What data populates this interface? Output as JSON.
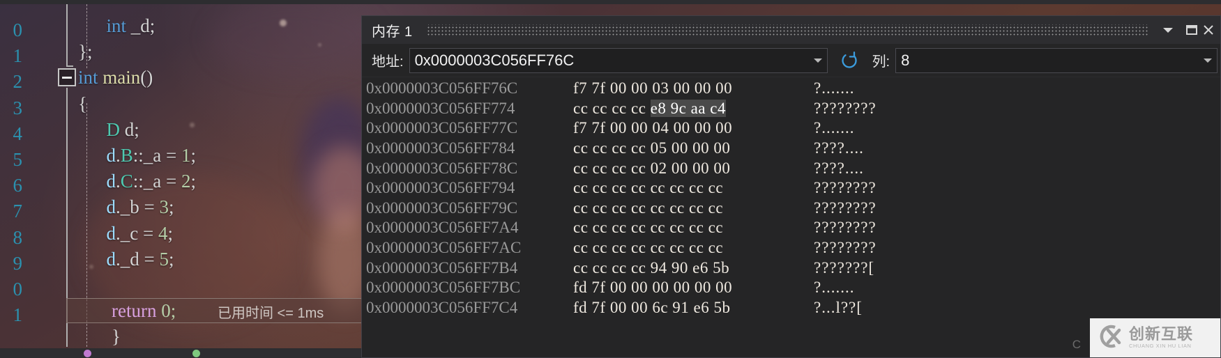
{
  "editor": {
    "line_numbers": [
      "0",
      "1",
      "2",
      "3",
      "4",
      "5",
      "6",
      "7",
      "8",
      "9",
      "0",
      "1"
    ],
    "code_lines": [
      {
        "indent": 3,
        "tokens": [
          {
            "t": "int",
            "c": "kw"
          },
          {
            "t": " _d;",
            "c": "pun"
          }
        ]
      },
      {
        "indent": 0,
        "tokens": [
          {
            "t": "};",
            "c": "pun"
          }
        ]
      },
      {
        "indent": 0,
        "tokens": [
          {
            "t": "int",
            "c": "kw"
          },
          {
            "t": " ",
            "c": "pun"
          },
          {
            "t": "main",
            "c": "fn"
          },
          {
            "t": "()",
            "c": "pun"
          }
        ]
      },
      {
        "indent": 0,
        "tokens": [
          {
            "t": "{",
            "c": "pun"
          }
        ]
      },
      {
        "indent": 3,
        "tokens": [
          {
            "t": "D",
            "c": "typ"
          },
          {
            "t": " d;",
            "c": "pun"
          }
        ]
      },
      {
        "indent": 3,
        "tokens": [
          {
            "t": "d",
            "c": "var"
          },
          {
            "t": ".",
            "c": "pun"
          },
          {
            "t": "B",
            "c": "typ"
          },
          {
            "t": "::",
            "c": "pun"
          },
          {
            "t": "_a",
            "c": "pun"
          },
          {
            "t": " = ",
            "c": "pun"
          },
          {
            "t": "1",
            "c": "num"
          },
          {
            "t": ";",
            "c": "pun"
          }
        ]
      },
      {
        "indent": 3,
        "tokens": [
          {
            "t": "d",
            "c": "var"
          },
          {
            "t": ".",
            "c": "pun"
          },
          {
            "t": "C",
            "c": "typ"
          },
          {
            "t": "::",
            "c": "pun"
          },
          {
            "t": "_a",
            "c": "pun"
          },
          {
            "t": " = ",
            "c": "pun"
          },
          {
            "t": "2",
            "c": "num"
          },
          {
            "t": ";",
            "c": "pun"
          }
        ]
      },
      {
        "indent": 3,
        "tokens": [
          {
            "t": "d",
            "c": "var"
          },
          {
            "t": "._b",
            "c": "pun"
          },
          {
            "t": " = ",
            "c": "pun"
          },
          {
            "t": "3",
            "c": "num"
          },
          {
            "t": ";",
            "c": "pun"
          }
        ]
      },
      {
        "indent": 3,
        "tokens": [
          {
            "t": "d",
            "c": "var"
          },
          {
            "t": "._c",
            "c": "pun"
          },
          {
            "t": " = ",
            "c": "pun"
          },
          {
            "t": "4",
            "c": "num"
          },
          {
            "t": ";",
            "c": "pun"
          }
        ]
      },
      {
        "indent": 3,
        "tokens": [
          {
            "t": "d",
            "c": "var"
          },
          {
            "t": "._d",
            "c": "pun"
          },
          {
            "t": " = ",
            "c": "pun"
          },
          {
            "t": "5",
            "c": "num"
          },
          {
            "t": ";",
            "c": "pun"
          }
        ]
      }
    ],
    "current_line": {
      "keyword": "return",
      "value": " 0;",
      "elapsed_text": "已用时间 <= 1ms"
    },
    "closing_brace": "}",
    "colors": {
      "line_number": "#2b91af",
      "keyword": "#569cd6",
      "function": "#dcdcaa",
      "type": "#4ec9b0",
      "variable": "#9cdcfe",
      "number": "#b5cea8",
      "control": "#d8a0df"
    }
  },
  "memory_window": {
    "title": "内存 1",
    "titlebar_icons": {
      "dropdown": "chevron-down-icon",
      "restore": "restore-window-icon",
      "close": "close-icon"
    },
    "toolbar": {
      "address_label": "地址:",
      "address_value": "0x0000003C056FF76C",
      "address_placeholder": "0x0000003C056FF76C",
      "refresh_icon": "refresh-icon",
      "refresh_color": "#3b9cdd",
      "column_label": "列:",
      "column_value": "8"
    },
    "rows": [
      {
        "address": "0x0000003C056FF76C",
        "hex_pre": "f7 7f 00 00 03 00 00 00",
        "hex_hl": "",
        "hex_post": "",
        "ascii": "?......."
      },
      {
        "address": "0x0000003C056FF774",
        "hex_pre": "cc cc cc cc ",
        "hex_hl": "e8 9c aa c4",
        "hex_post": "",
        "ascii": "????????"
      },
      {
        "address": "0x0000003C056FF77C",
        "hex_pre": "f7 7f 00 00 04 00 00 00",
        "hex_hl": "",
        "hex_post": "",
        "ascii": "?......."
      },
      {
        "address": "0x0000003C056FF784",
        "hex_pre": "cc cc cc cc 05 00 00 00",
        "hex_hl": "",
        "hex_post": "",
        "ascii": "????...."
      },
      {
        "address": "0x0000003C056FF78C",
        "hex_pre": "cc cc cc cc 02 00 00 00",
        "hex_hl": "",
        "hex_post": "",
        "ascii": "????...."
      },
      {
        "address": "0x0000003C056FF794",
        "hex_pre": "cc cc cc cc cc cc cc cc",
        "hex_hl": "",
        "hex_post": "",
        "ascii": "????????"
      },
      {
        "address": "0x0000003C056FF79C",
        "hex_pre": "cc cc cc cc cc cc cc cc",
        "hex_hl": "",
        "hex_post": "",
        "ascii": "????????"
      },
      {
        "address": "0x0000003C056FF7A4",
        "hex_pre": "cc cc cc cc cc cc cc cc",
        "hex_hl": "",
        "hex_post": "",
        "ascii": "????????"
      },
      {
        "address": "0x0000003C056FF7AC",
        "hex_pre": "cc cc cc cc cc cc cc cc",
        "hex_hl": "",
        "hex_post": "",
        "ascii": "????????"
      },
      {
        "address": "0x0000003C056FF7B4",
        "hex_pre": "cc cc cc cc 94 90 e6 5b",
        "hex_hl": "",
        "hex_post": "",
        "ascii": "???????["
      },
      {
        "address": "0x0000003C056FF7BC",
        "hex_pre": "fd 7f 00 00 00 00 00 00",
        "hex_hl": "",
        "hex_post": "",
        "ascii": "?......."
      },
      {
        "address": "0x0000003C056FF7C4",
        "hex_pre": "fd 7f 00 00 6c 91 e6 5b",
        "hex_hl": "",
        "hex_post": "",
        "ascii": "?...l??["
      }
    ]
  },
  "watermark": {
    "logo": "cx-logo-icon",
    "chinese": "创新互联",
    "pinyin": "CHUANG XIN HU LIAN",
    "c_mark": "C"
  }
}
